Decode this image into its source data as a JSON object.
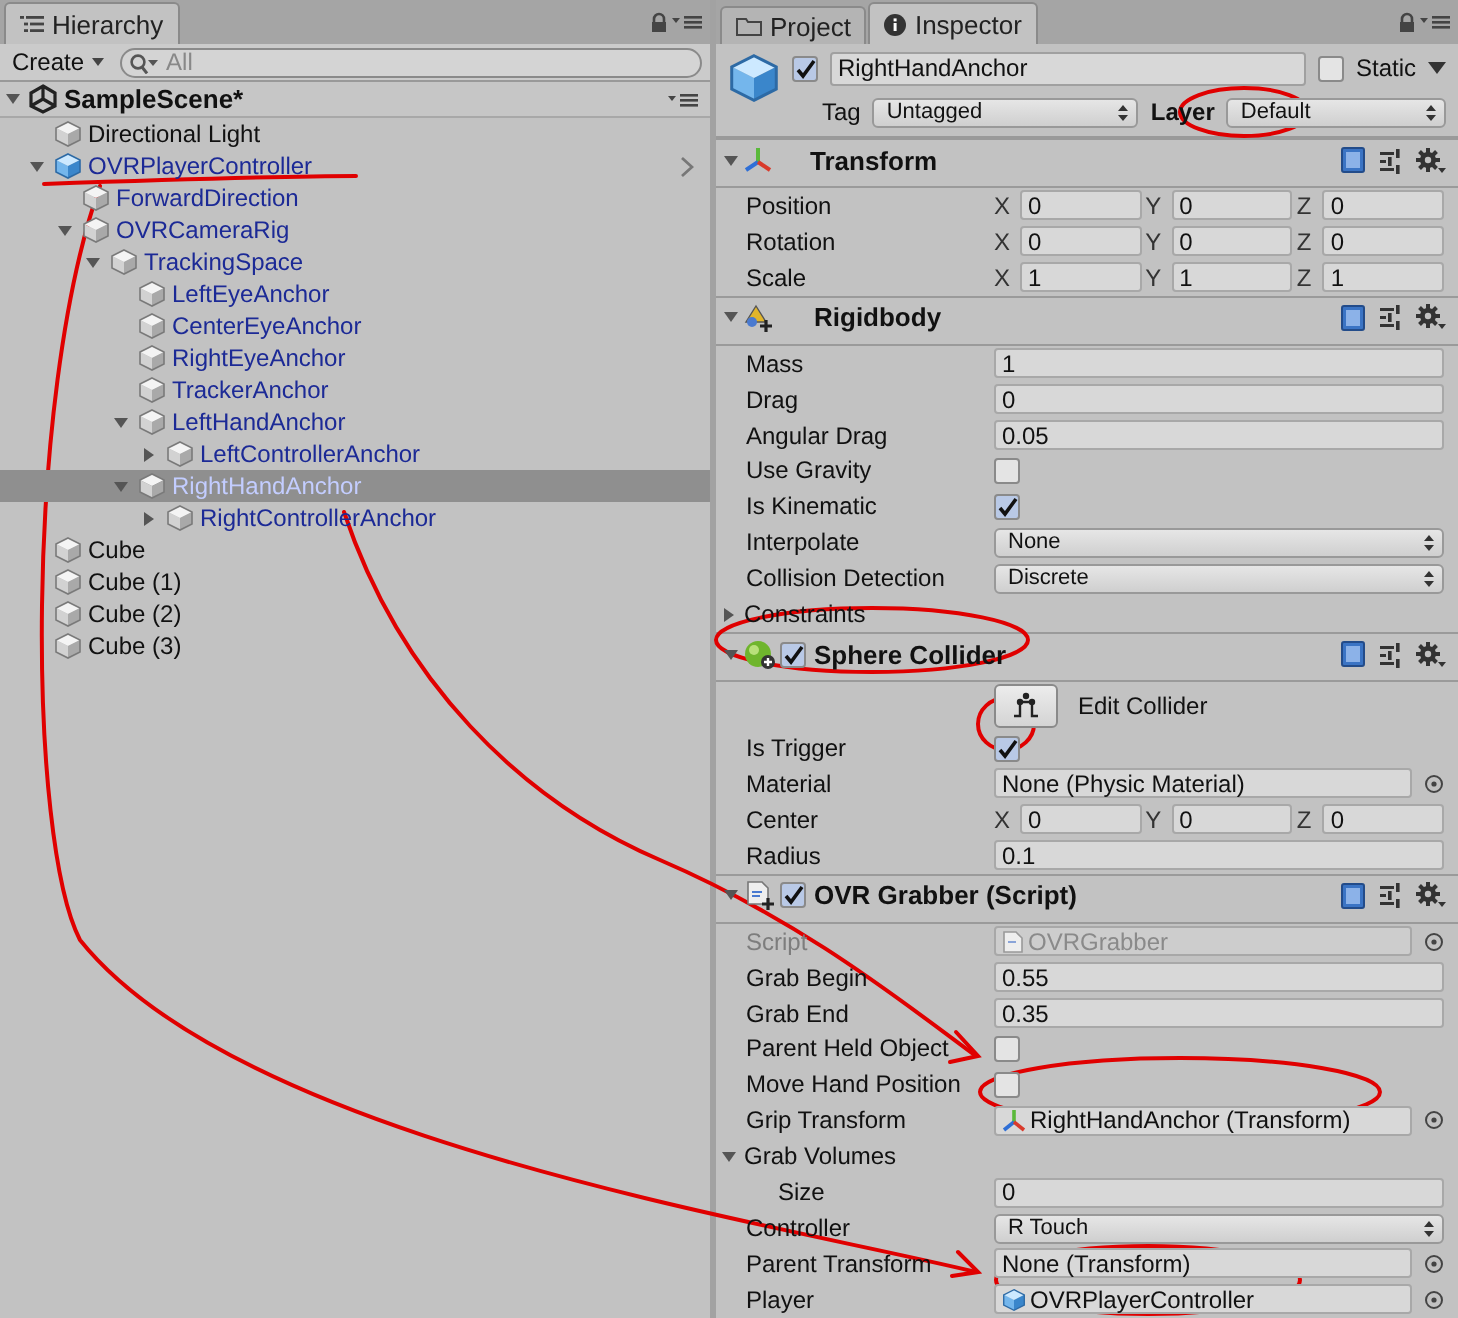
{
  "hierarchy": {
    "tab": "Hierarchy",
    "create": "Create",
    "search": {
      "placeholder": "All"
    },
    "scene": {
      "name": "SampleScene*",
      "expanded": true
    },
    "items": [
      {
        "name": "Directional Light",
        "kind": "object",
        "selected": false
      },
      {
        "name": "OVRPlayerController",
        "kind": "prefab_root",
        "selected": false,
        "expanded": true,
        "children": [
          {
            "name": "ForwardDirection",
            "kind": "prefab",
            "selected": false
          },
          {
            "name": "OVRCameraRig",
            "kind": "prefab",
            "selected": false,
            "expanded": true,
            "children": [
              {
                "name": "TrackingSpace",
                "kind": "prefab",
                "selected": false,
                "expanded": true,
                "children": [
                  {
                    "name": "LeftEyeAnchor",
                    "kind": "prefab",
                    "selected": false
                  },
                  {
                    "name": "CenterEyeAnchor",
                    "kind": "prefab",
                    "selected": false
                  },
                  {
                    "name": "RightEyeAnchor",
                    "kind": "prefab",
                    "selected": false
                  },
                  {
                    "name": "TrackerAnchor",
                    "kind": "prefab",
                    "selected": false
                  },
                  {
                    "name": "LeftHandAnchor",
                    "kind": "prefab",
                    "selected": false,
                    "expanded": true,
                    "children": [
                      {
                        "name": "LeftControllerAnchor",
                        "kind": "prefab",
                        "selected": false,
                        "expanded": false
                      }
                    ]
                  },
                  {
                    "name": "RightHandAnchor",
                    "kind": "prefab",
                    "selected": true,
                    "expanded": true,
                    "children": [
                      {
                        "name": "RightControllerAnchor",
                        "kind": "prefab",
                        "selected": false,
                        "expanded": false
                      }
                    ]
                  }
                ]
              }
            ]
          }
        ]
      },
      {
        "name": "Cube",
        "kind": "object",
        "selected": false
      },
      {
        "name": "Cube (1)",
        "kind": "object",
        "selected": false
      },
      {
        "name": "Cube (2)",
        "kind": "object",
        "selected": false
      },
      {
        "name": "Cube (3)",
        "kind": "object",
        "selected": false
      }
    ]
  },
  "inspector": {
    "tabs": [
      {
        "label": "Project",
        "selected": false
      },
      {
        "label": "Inspector",
        "selected": true
      }
    ],
    "object": {
      "active": true,
      "name": "RightHandAnchor",
      "static": {
        "label": "Static",
        "checked": false
      },
      "tag": {
        "label": "Tag",
        "value": "Untagged"
      },
      "layer": {
        "label": "Layer",
        "value": "Default"
      }
    },
    "components": [
      {
        "title": "Transform",
        "kind": "transform",
        "expanded": true,
        "fields": [
          {
            "kind": "vector",
            "label": "Position",
            "axes": [
              {
                "axis": "X",
                "value": "0"
              },
              {
                "axis": "Y",
                "value": "0"
              },
              {
                "axis": "Z",
                "value": "0"
              }
            ]
          },
          {
            "kind": "vector",
            "label": "Rotation",
            "axes": [
              {
                "axis": "X",
                "value": "0"
              },
              {
                "axis": "Y",
                "value": "0"
              },
              {
                "axis": "Z",
                "value": "0"
              }
            ]
          },
          {
            "kind": "vector",
            "label": "Scale",
            "axes": [
              {
                "axis": "X",
                "value": "1"
              },
              {
                "axis": "Y",
                "value": "1"
              },
              {
                "axis": "Z",
                "value": "1"
              }
            ]
          }
        ]
      },
      {
        "title": "Rigidbody",
        "kind": "rigidbody",
        "expanded": true,
        "fields": [
          {
            "kind": "text",
            "label": "Mass",
            "value": "1"
          },
          {
            "kind": "text",
            "label": "Drag",
            "value": "0"
          },
          {
            "kind": "text",
            "label": "Angular Drag",
            "value": "0.05"
          },
          {
            "kind": "checkbox",
            "label": "Use Gravity",
            "checked": false
          },
          {
            "kind": "checkbox",
            "label": "Is Kinematic",
            "checked": true
          },
          {
            "kind": "dropdown",
            "label": "Interpolate",
            "value": "None"
          },
          {
            "kind": "dropdown",
            "label": "Collision Detection",
            "value": "Discrete"
          },
          {
            "kind": "foldout",
            "label": "Constraints",
            "expanded": false
          }
        ]
      },
      {
        "title": "Sphere Collider",
        "kind": "collider",
        "enabled": true,
        "expanded": true,
        "fields": [
          {
            "kind": "edit_button",
            "label": "Edit Collider"
          },
          {
            "kind": "checkbox",
            "label": "Is Trigger",
            "checked": true
          },
          {
            "kind": "object",
            "label": "Material",
            "value": "None (Physic Material)"
          },
          {
            "kind": "vector",
            "label": "Center",
            "axes": [
              {
                "axis": "X",
                "value": "0"
              },
              {
                "axis": "Y",
                "value": "0"
              },
              {
                "axis": "Z",
                "value": "0"
              }
            ]
          },
          {
            "kind": "text",
            "label": "Radius",
            "value": "0.1"
          }
        ]
      },
      {
        "title": "OVR Grabber (Script)",
        "kind": "script",
        "enabled": true,
        "expanded": true,
        "fields": [
          {
            "kind": "script_ref",
            "label": "Script",
            "value": "OVRGrabber",
            "disabled": true
          },
          {
            "kind": "text",
            "label": "Grab Begin",
            "value": "0.55"
          },
          {
            "kind": "text",
            "label": "Grab End",
            "value": "0.35"
          },
          {
            "kind": "checkbox",
            "label": "Parent Held Object",
            "checked": false
          },
          {
            "kind": "checkbox",
            "label": "Move Hand Position",
            "checked": false
          },
          {
            "kind": "transform_ref",
            "label": "Grip Transform",
            "value": "RightHandAnchor (Transform)"
          },
          {
            "kind": "foldout",
            "label": "Grab Volumes",
            "expanded": true,
            "children": [
              {
                "kind": "text",
                "label": "Size",
                "value": "0"
              }
            ]
          },
          {
            "kind": "dropdown",
            "label": "Controller",
            "value": "R Touch"
          },
          {
            "kind": "object",
            "label": "Parent Transform",
            "value": "None (Transform)"
          },
          {
            "kind": "prefab_ref",
            "label": "Player",
            "value": "OVRPlayerController"
          }
        ]
      }
    ]
  }
}
